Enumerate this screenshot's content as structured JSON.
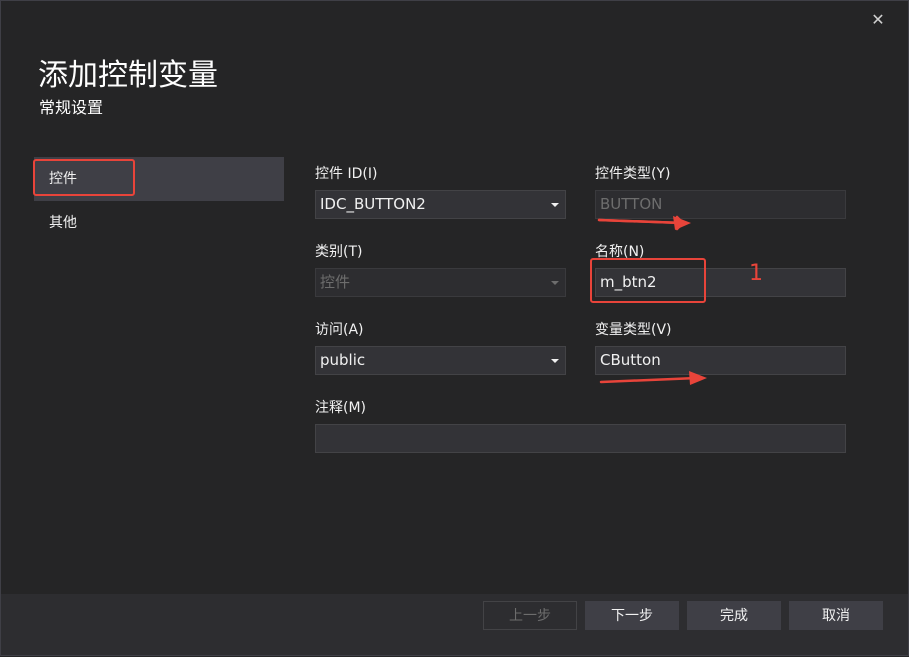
{
  "dialog": {
    "title": "添加控制变量",
    "subtitle": "常规设置",
    "close_glyph": "✕"
  },
  "sidebar": {
    "items": [
      {
        "label": "控件",
        "selected": true
      },
      {
        "label": "其他",
        "selected": false
      }
    ]
  },
  "form": {
    "control_id": {
      "label": "控件 ID(I)",
      "value": "IDC_BUTTON2"
    },
    "control_type": {
      "label": "控件类型(Y)",
      "value": "BUTTON"
    },
    "category": {
      "label": "类别(T)",
      "value": "控件"
    },
    "name": {
      "label": "名称(N)",
      "value": "m_btn2"
    },
    "access": {
      "label": "访问(A)",
      "value": "public"
    },
    "variable_type": {
      "label": "变量类型(V)",
      "value": "CButton"
    },
    "comment": {
      "label": "注释(M)",
      "value": ""
    }
  },
  "footer": {
    "prev_label": "上一步",
    "next_label": "下一步",
    "finish_label": "完成",
    "cancel_label": "取消"
  },
  "annotations": {
    "number": "1",
    "color": "#e8443a"
  },
  "colors": {
    "background": "#252526",
    "field": "#333337",
    "button": "#3f3f46",
    "text": "#f1f1f1"
  }
}
